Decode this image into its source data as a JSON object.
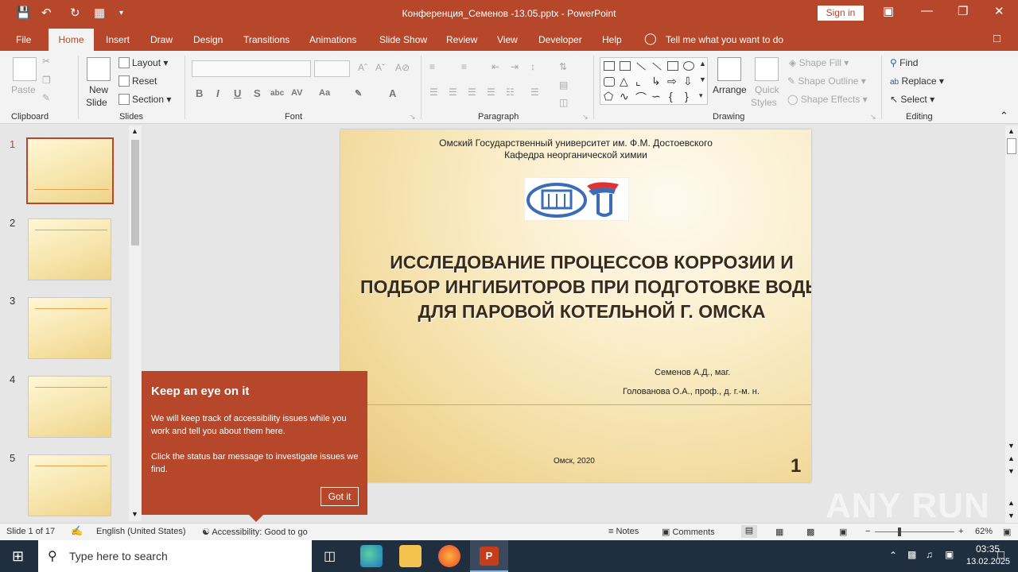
{
  "window": {
    "title": "Конференция_Семенов -13.05.pptx  -  PowerPoint",
    "sign_in": "Sign in"
  },
  "menu": {
    "tabs": [
      "File",
      "Home",
      "Insert",
      "Draw",
      "Design",
      "Transitions",
      "Animations",
      "Slide Show",
      "Review",
      "View",
      "Developer",
      "Help"
    ],
    "active": "Home",
    "tell_me": "Tell me what you want to do"
  },
  "ribbon": {
    "clipboard": {
      "label": "Clipboard",
      "paste": "Paste"
    },
    "slides": {
      "label": "Slides",
      "new_slide_1": "New",
      "new_slide_2": "Slide",
      "layout": "Layout",
      "reset": "Reset",
      "section": "Section"
    },
    "font": {
      "label": "Font",
      "font_name": "",
      "font_size": ""
    },
    "paragraph": {
      "label": "Paragraph"
    },
    "drawing": {
      "label": "Drawing",
      "arrange": "Arrange",
      "quick_styles_1": "Quick",
      "quick_styles_2": "Styles",
      "shape_fill": "Shape Fill",
      "shape_outline": "Shape Outline",
      "shape_effects": "Shape Effects"
    },
    "editing": {
      "label": "Editing",
      "find": "Find",
      "replace": "Replace",
      "select": "Select"
    }
  },
  "thumbnails": [
    "1",
    "2",
    "3",
    "4",
    "5"
  ],
  "selected_thumbnail": "1",
  "slide": {
    "university": "Омский Государственный  университет  им.  Ф.М. Достоевского",
    "department": "Кафедра  неорганической химии",
    "heading": "ИССЛЕДОВАНИЕ ПРОЦЕССОВ КОРРОЗИИ И ПОДБОР ИНГИБИТОРОВ ПРИ ПОДГОТОВКЕ ВОДЫ ДЛЯ ПАРОВОЙ КОТЕЛЬНОЙ Г. ОМСКА",
    "author1": "Семенов А.Д., маг.",
    "author2": "Голованова О.А., проф., д. г.-м. н.",
    "city_year": "Омск, 2020",
    "number": "1"
  },
  "popup": {
    "title": "Keep an eye on it",
    "body1": "We will keep track of accessibility issues while you work and tell you about them here.",
    "body2": "Click the status bar message to investigate issues we find.",
    "button": "Got it"
  },
  "status": {
    "slide": "Slide 1 of 17",
    "language": "English (United States)",
    "accessibility": "Accessibility: Good to go",
    "notes": "Notes",
    "comments": "Comments",
    "zoom": "62%"
  },
  "taskbar": {
    "search_placeholder": "Type here to search",
    "time": "03:35",
    "date": "13.02.2025"
  },
  "watermark": "ANY RUN",
  "colors": {
    "accent": "#b7472a",
    "taskbar": "#1f2f3f"
  }
}
